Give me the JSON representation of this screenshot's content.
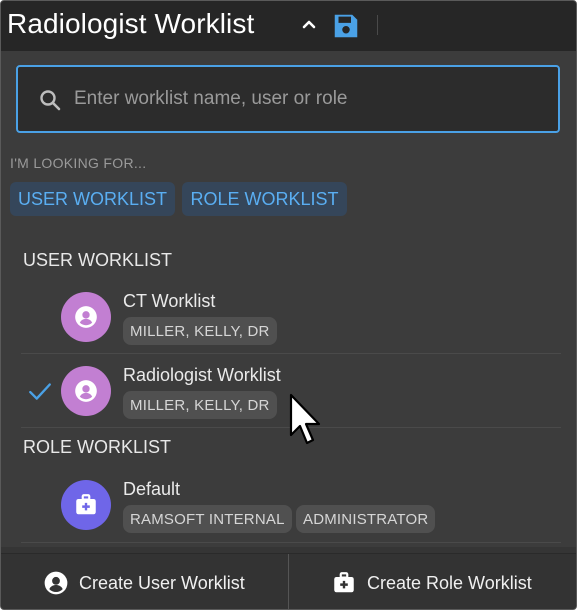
{
  "header": {
    "title": "Radiologist Worklist",
    "icons": [
      "chevron-up-icon",
      "save-icon"
    ]
  },
  "search": {
    "placeholder": "Enter worklist name, user or role",
    "value": ""
  },
  "filters": {
    "heading": "I'M LOOKING FOR...",
    "options": [
      "USER WORKLIST",
      "ROLE WORKLIST"
    ]
  },
  "user_section": {
    "title": "USER WORKLIST",
    "items": [
      {
        "name": "CT Worklist",
        "owner": "MILLER, KELLY, DR",
        "selected": false
      },
      {
        "name": "Radiologist Worklist",
        "owner": "MILLER, KELLY, DR",
        "selected": true
      }
    ]
  },
  "role_section": {
    "title": "ROLE WORKLIST",
    "items": [
      {
        "name": "Default",
        "tags": [
          "RAMSOFT INTERNAL",
          "ADMINISTRATOR"
        ]
      }
    ]
  },
  "footer": {
    "create_user": "Create User Worklist",
    "create_role": "Create Role Worklist"
  },
  "colors": {
    "accent": "#4aa1e6",
    "user_avatar": "#c27fd2",
    "role_avatar": "#6f66e8",
    "panel_bg": "#3c3c3c",
    "header_bg": "#262626"
  }
}
